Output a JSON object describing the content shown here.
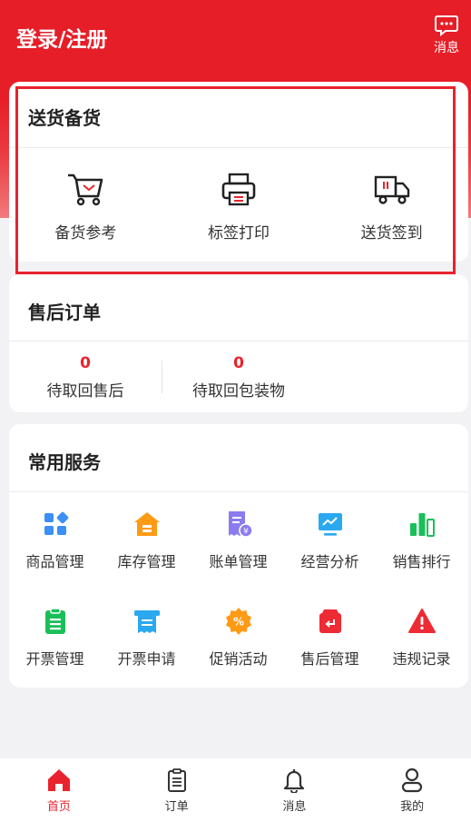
{
  "header": {
    "title": "登录/注册",
    "message_label": "消息"
  },
  "delivery": {
    "title": "送货备货",
    "items": [
      {
        "label": "备货参考",
        "icon": "cart-icon"
      },
      {
        "label": "标签打印",
        "icon": "printer-icon"
      },
      {
        "label": "送货签到",
        "icon": "truck-icon"
      }
    ]
  },
  "aftersale": {
    "title": "售后订单",
    "stats": [
      {
        "value": "0",
        "label": "待取回售后"
      },
      {
        "value": "0",
        "label": "待取回包装物"
      }
    ]
  },
  "services": {
    "title": "常用服务",
    "items": [
      {
        "label": "商品管理",
        "icon": "goods-icon",
        "color": "#3b8ff5"
      },
      {
        "label": "库存管理",
        "icon": "warehouse-icon",
        "color": "#ff9a14"
      },
      {
        "label": "账单管理",
        "icon": "bill-icon",
        "color": "#8a7cf0"
      },
      {
        "label": "经营分析",
        "icon": "analysis-icon",
        "color": "#2aa8f0"
      },
      {
        "label": "销售排行",
        "icon": "ranking-icon",
        "color": "#1bbf5a"
      },
      {
        "label": "开票管理",
        "icon": "invoice-icon",
        "color": "#1bbf5a"
      },
      {
        "label": "开票申请",
        "icon": "invoice-apply-icon",
        "color": "#2aa8f0"
      },
      {
        "label": "促销活动",
        "icon": "promotion-icon",
        "color": "#ff9a14"
      },
      {
        "label": "售后管理",
        "icon": "aftersale-icon",
        "color": "#ee2a34"
      },
      {
        "label": "违规记录",
        "icon": "warning-icon",
        "color": "#ee2a34"
      }
    ]
  },
  "tabbar": {
    "items": [
      {
        "label": "首页",
        "icon": "home-icon",
        "active": true
      },
      {
        "label": "订单",
        "icon": "order-icon",
        "active": false
      },
      {
        "label": "消息",
        "icon": "bell-icon",
        "active": false
      },
      {
        "label": "我的",
        "icon": "user-icon",
        "active": false
      }
    ]
  },
  "colors": {
    "brand": "#e61e27",
    "accent_red": "#e8232d",
    "background": "#f2f2f4"
  }
}
